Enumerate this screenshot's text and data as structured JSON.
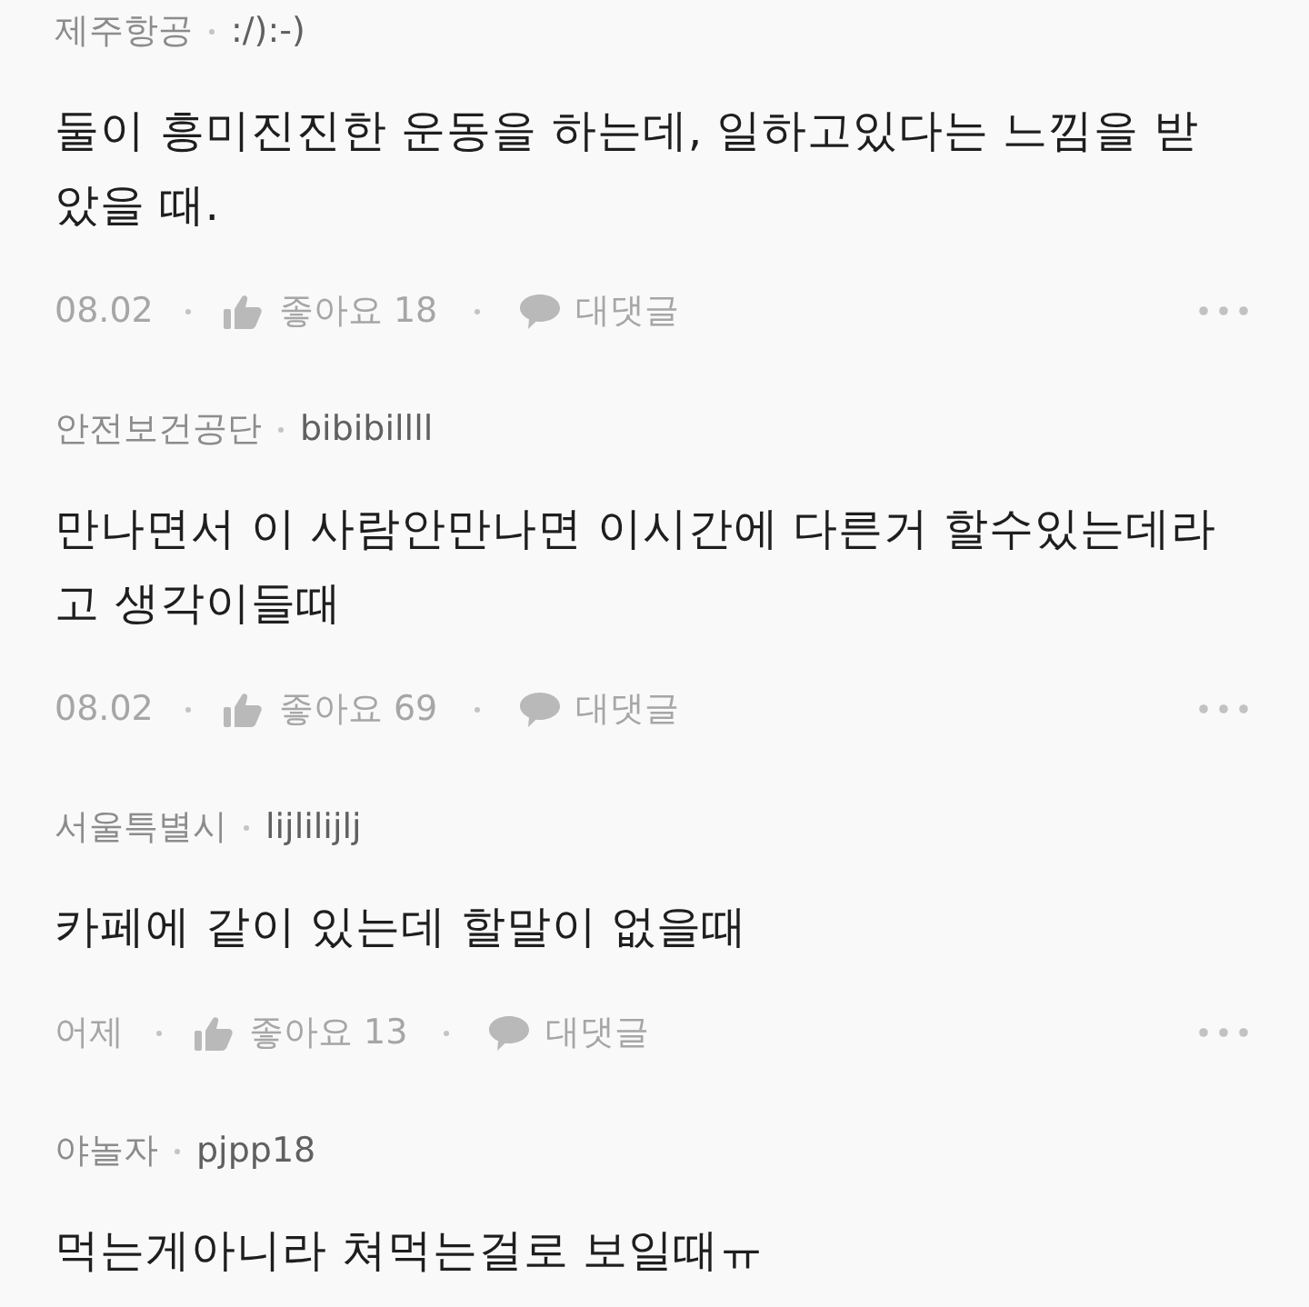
{
  "comments": [
    {
      "location": "제주항공",
      "username": ":/):-)",
      "body": "둘이 흥미진진한 운동을 하는데, 일하고있다는 느낌을 받았을 때.",
      "date": "08.02",
      "likes": "좋아요 18",
      "reply": "대댓글"
    },
    {
      "location": "안전보건공단",
      "username": "bibibillll",
      "body": "만나면서 이 사람안만나면 이시간에 다른거 할수있는데라고 생각이들때",
      "date": "08.02",
      "likes": "좋아요 69",
      "reply": "대댓글"
    },
    {
      "location": "서울특별시",
      "username": "lijlilijlj",
      "body": "카페에 같이 있는데 할말이 없을때",
      "date": "어제",
      "likes": "좋아요 13",
      "reply": "대댓글"
    },
    {
      "location": "야놀자",
      "username": "pjpp18",
      "body": "먹는게아니라 쳐먹는걸로 보일때ㅠ"
    }
  ]
}
